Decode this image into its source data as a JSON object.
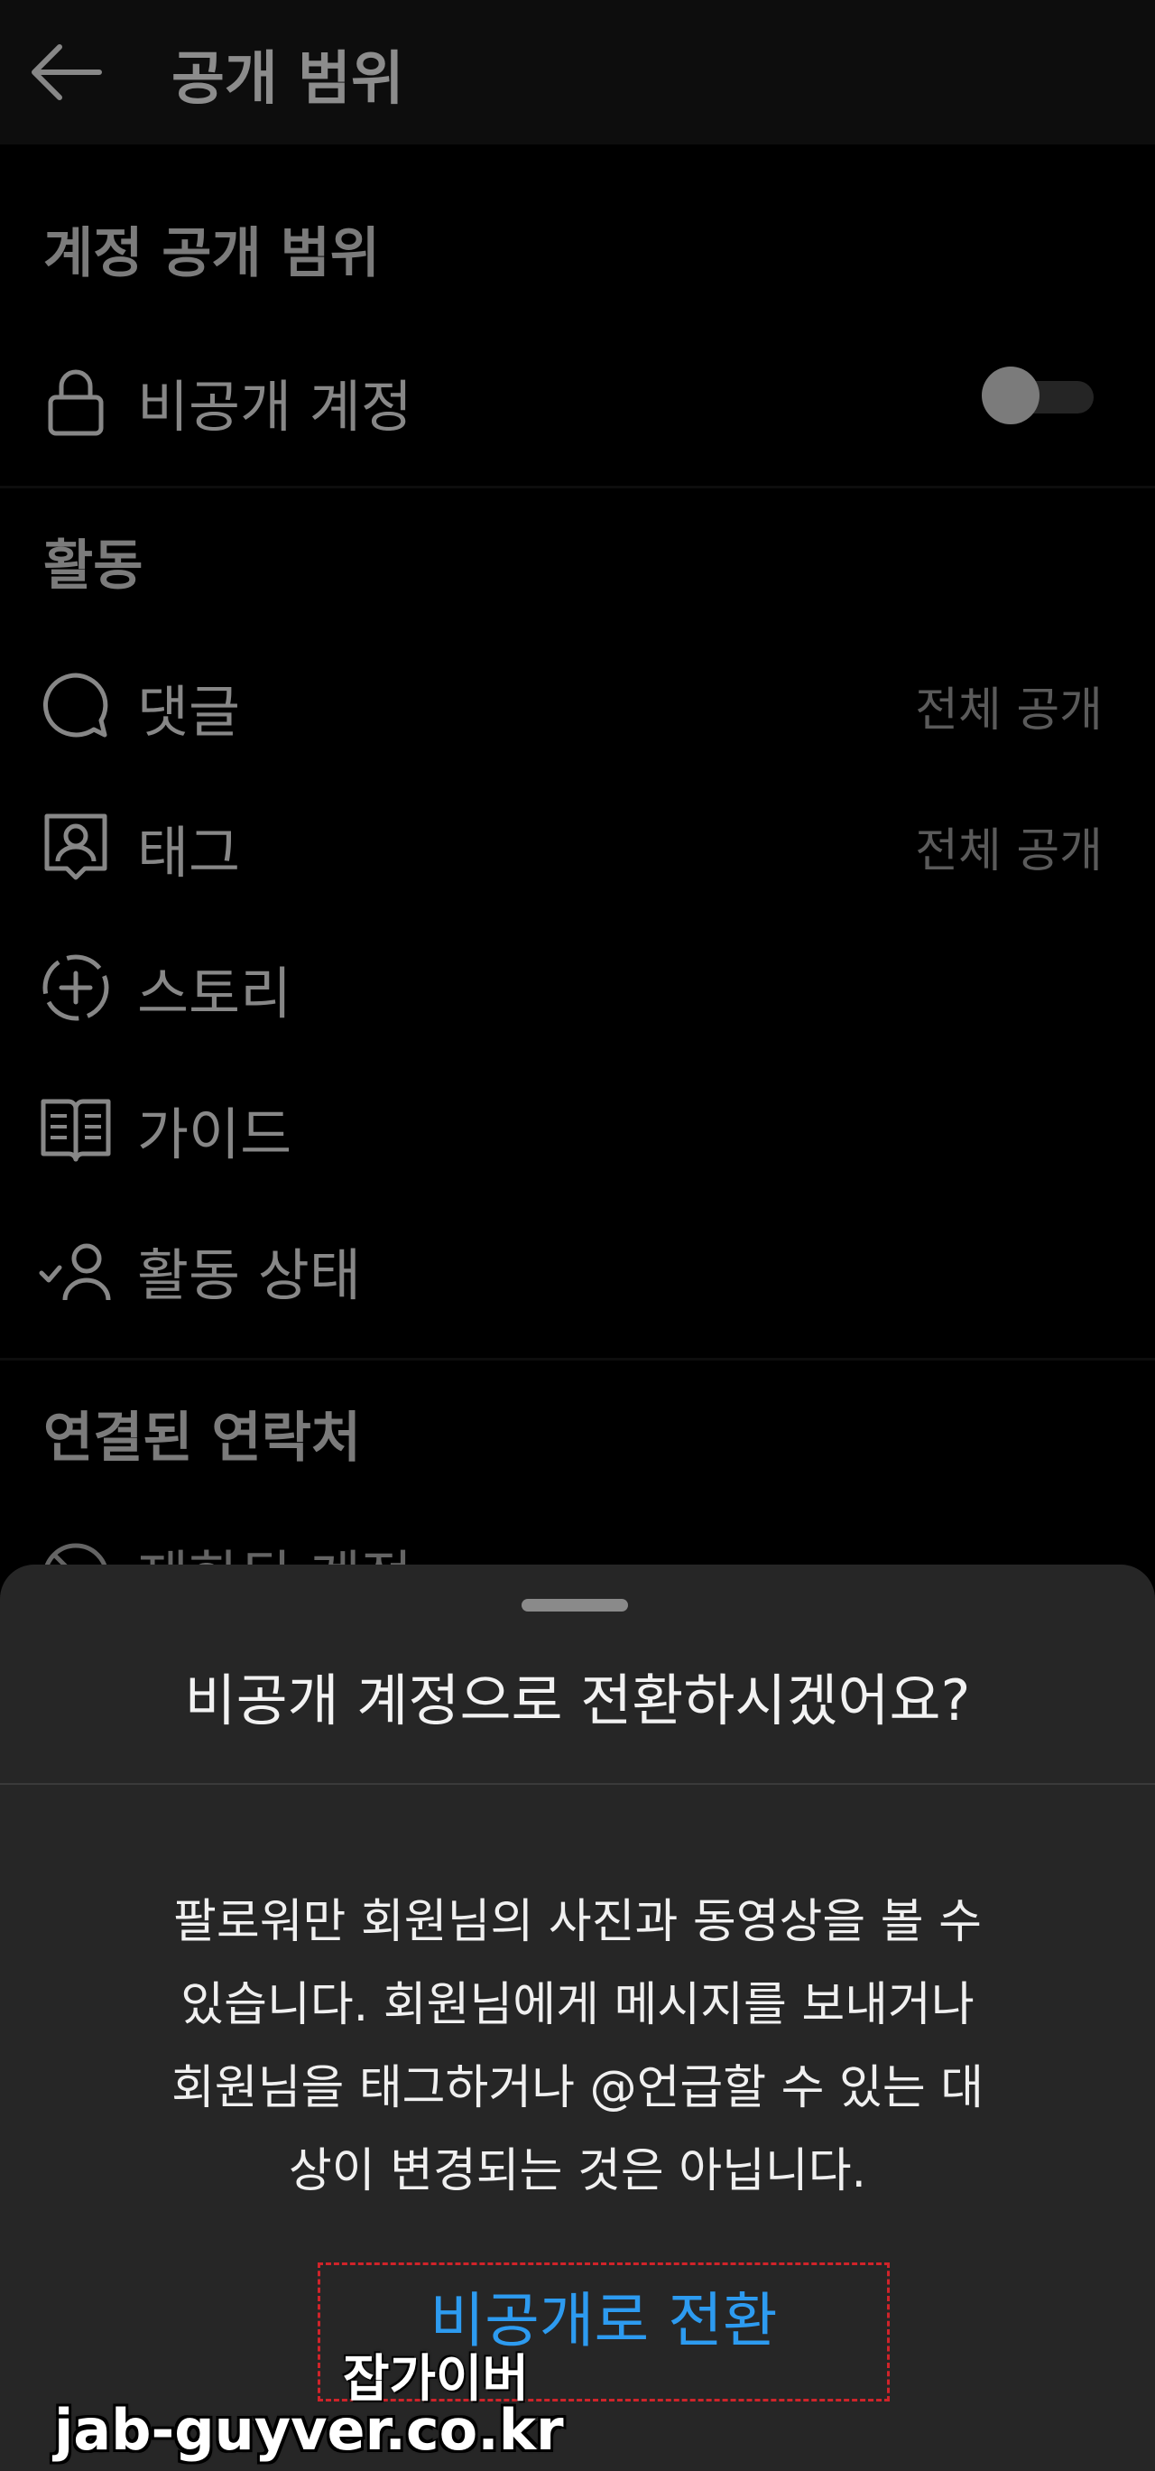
{
  "header": {
    "title": "공개 범위"
  },
  "account_section": {
    "title": "계정 공개 범위",
    "private_account": {
      "label": "비공개 계정",
      "enabled": false,
      "icon": "lock-icon"
    }
  },
  "activity_section": {
    "title": "활동",
    "items": [
      {
        "label": "댓글",
        "value": "전체 공개",
        "icon": "comment-icon"
      },
      {
        "label": "태그",
        "value": "전체 공개",
        "icon": "tag-person-icon"
      },
      {
        "label": "스토리",
        "value": "",
        "icon": "story-add-icon"
      },
      {
        "label": "가이드",
        "value": "",
        "icon": "guide-book-icon"
      },
      {
        "label": "활동 상태",
        "value": "",
        "icon": "activity-status-icon"
      }
    ]
  },
  "contacts_section": {
    "title": "연결된 연락처",
    "partial_item": {
      "label": "제한된 계정",
      "icon": "restricted-icon"
    }
  },
  "sheet": {
    "title": "비공개 계정으로 전환하시겠어요?",
    "body_lines": [
      "팔로워만 회원님의 사진과 동영상을 볼 수",
      "있습니다. 회원님에게 메시지를 보내거나",
      "회원님을 태그하거나 @언급할 수 있는 대",
      "상이 변경되는 것은 아닙니다."
    ],
    "confirm_label": "비공개로 전환"
  },
  "watermark": {
    "name": "잡가이버",
    "url": "jab-guyver.co.kr"
  },
  "colors": {
    "accent": "#2d9bf0",
    "highlight_box": "#d0232a"
  }
}
